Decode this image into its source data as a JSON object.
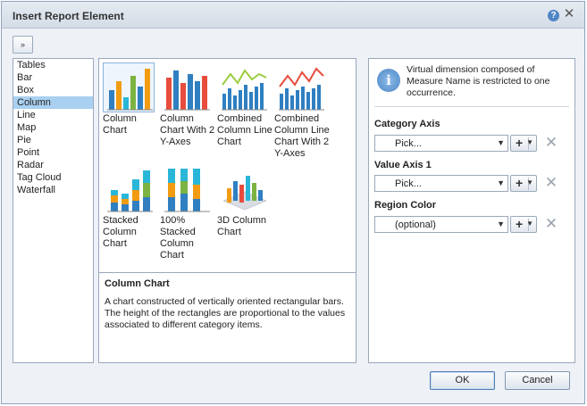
{
  "dialog": {
    "title": "Insert Report Element"
  },
  "toolbar": {
    "button_icon": "collapse-icon"
  },
  "categories": [
    {
      "label": "Tables"
    },
    {
      "label": "Bar"
    },
    {
      "label": "Box"
    },
    {
      "label": "Column",
      "selected": true
    },
    {
      "label": "Line"
    },
    {
      "label": "Map"
    },
    {
      "label": "Pie"
    },
    {
      "label": "Point"
    },
    {
      "label": "Radar"
    },
    {
      "label": "Tag Cloud"
    },
    {
      "label": "Waterfall"
    }
  ],
  "gallery": [
    {
      "label": "Column Chart",
      "icon": "column-chart-icon",
      "selected": true
    },
    {
      "label": "Column Chart With 2 Y-Axes",
      "icon": "column-chart-2y-icon"
    },
    {
      "label": "Combined Column Line Chart",
      "icon": "combined-column-line-icon"
    },
    {
      "label": "Combined Column Line Chart With 2 Y-Axes",
      "icon": "combined-column-line-2y-icon"
    },
    {
      "label": "Stacked Column Chart",
      "icon": "stacked-column-icon"
    },
    {
      "label": "100% Stacked Column Chart",
      "icon": "stacked-100-column-icon"
    },
    {
      "label": "3D Column Chart",
      "icon": "column-3d-icon"
    }
  ],
  "description": {
    "title": "Column Chart",
    "body": "A chart constructed of vertically oriented rectangular bars. The height of the rectangles are proportional to the values associated to different category items."
  },
  "info": {
    "text": "Virtual dimension composed of Measure Name is restricted to one occurrence."
  },
  "fields": [
    {
      "label": "Category Axis",
      "value": "Pick..."
    },
    {
      "label": "Value Axis 1",
      "value": "Pick..."
    },
    {
      "label": "Region Color",
      "value": "(optional)"
    }
  ],
  "buttons": {
    "ok": "OK",
    "cancel": "Cancel"
  },
  "colors": {
    "blue": "#2f7fc1",
    "orange": "#f39c12",
    "green": "#7cb342",
    "red": "#e74c3c",
    "cyan": "#29b6d8"
  }
}
